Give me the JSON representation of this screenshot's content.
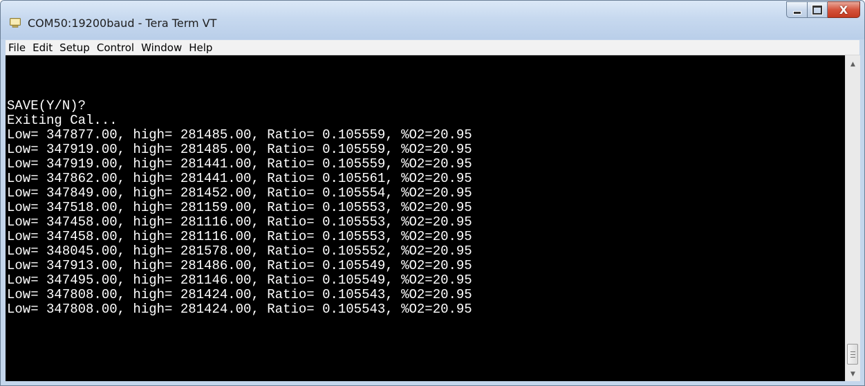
{
  "window": {
    "title": "COM50:19200baud - Tera Term VT",
    "icon": "tera-term-app-icon",
    "buttons": {
      "minimize_icon": "minimize-icon",
      "maximize_icon": "maximize-icon",
      "close_label": "X"
    }
  },
  "menu": {
    "items": [
      "File",
      "Edit",
      "Setup",
      "Control",
      "Window",
      "Help"
    ]
  },
  "terminal": {
    "background": "#000000",
    "foreground": "#ffffff",
    "lines": [
      "",
      "",
      "",
      "SAVE(Y/N)?",
      "Exiting Cal...",
      "Low= 347877.00, high= 281485.00, Ratio= 0.105559, %O2=20.95",
      "Low= 347919.00, high= 281485.00, Ratio= 0.105559, %O2=20.95",
      "Low= 347919.00, high= 281441.00, Ratio= 0.105559, %O2=20.95",
      "Low= 347862.00, high= 281441.00, Ratio= 0.105561, %O2=20.95",
      "Low= 347849.00, high= 281452.00, Ratio= 0.105554, %O2=20.95",
      "Low= 347518.00, high= 281159.00, Ratio= 0.105553, %O2=20.95",
      "Low= 347458.00, high= 281116.00, Ratio= 0.105553, %O2=20.95",
      "Low= 347458.00, high= 281116.00, Ratio= 0.105553, %O2=20.95",
      "Low= 348045.00, high= 281578.00, Ratio= 0.105552, %O2=20.95",
      "Low= 347913.00, high= 281486.00, Ratio= 0.105549, %O2=20.95",
      "Low= 347495.00, high= 281146.00, Ratio= 0.105549, %O2=20.95",
      "Low= 347808.00, high= 281424.00, Ratio= 0.105543, %O2=20.95",
      "Low= 347808.00, high= 281424.00, Ratio= 0.105543, %O2=20.95"
    ]
  },
  "scrollbar": {
    "up_icon": "scroll-up-arrow-icon",
    "down_icon": "scroll-down-arrow-icon",
    "position": 1.0
  }
}
